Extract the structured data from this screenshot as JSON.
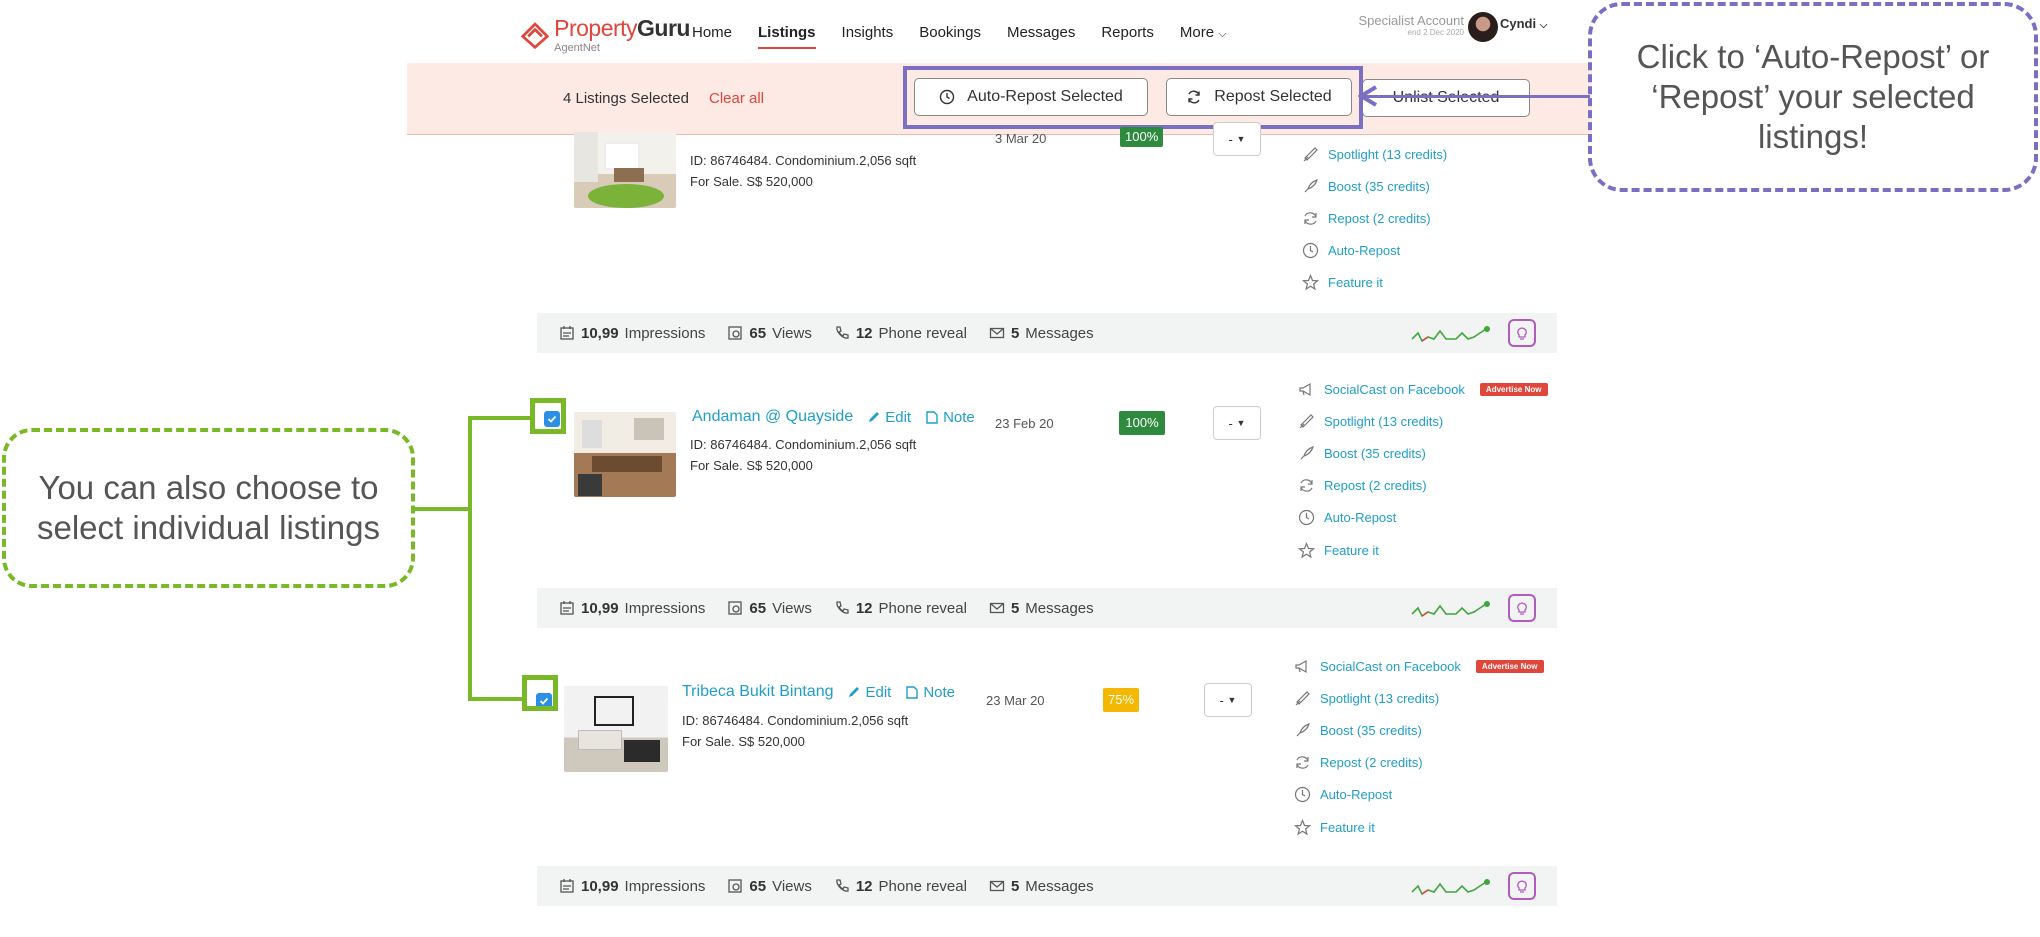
{
  "header": {
    "logo_main": "Property",
    "logo_bold": "Guru",
    "logo_sub": "AgentNet",
    "nav": [
      "Home",
      "Listings",
      "Insights",
      "Bookings",
      "Messages",
      "Reports",
      "More"
    ],
    "account_label": "Specialist Account",
    "account_sub": "end 2 Dec 2020",
    "user_name": "Cyndi"
  },
  "selection_bar": {
    "count_text": "4 Listings Selected",
    "clear_all": "Clear all",
    "auto_repost": "Auto-Repost Selected",
    "repost": "Repost Selected",
    "unlist": "Unlist Selected"
  },
  "listings": [
    {
      "title": "",
      "meta_id": "ID: 86746484.  Condominium.2,056 sqft",
      "meta_sale": "For Sale. S$ 520,000",
      "date": "3 Mar 20",
      "pct": "100%",
      "drop": "-",
      "actions": [
        "Spotlight (13 credits)",
        "Boost (35 credits)",
        "Repost (2 credits)",
        "Auto-Repost",
        "Feature it"
      ]
    },
    {
      "title": "Andaman @ Quayside",
      "edit": "Edit",
      "note": "Note",
      "meta_id": "ID: 86746484.  Condominium.2,056 sqft",
      "meta_sale": "For Sale. S$ 520,000",
      "date": "23 Feb 20",
      "pct": "100%",
      "drop": "-",
      "social": "SocialCast on Facebook",
      "badge": "Advertise Now",
      "actions": [
        "Spotlight (13 credits)",
        "Boost (35 credits)",
        "Repost (2 credits)",
        "Auto-Repost",
        "Feature it"
      ]
    },
    {
      "title": "Tribeca Bukit Bintang",
      "edit": "Edit",
      "note": "Note",
      "meta_id": "ID: 86746484.  Condominium.2,056 sqft",
      "meta_sale": "For Sale. S$ 520,000",
      "date": "23 Mar 20",
      "pct": "75%",
      "drop": "-",
      "social": "SocialCast on Facebook",
      "badge": "Advertise Now",
      "actions": [
        "Spotlight (13 credits)",
        "Boost (35 credits)",
        "Repost (2 credits)",
        "Auto-Repost",
        "Feature it"
      ]
    }
  ],
  "stats": {
    "impressions_val": "10,99",
    "impressions": "Impressions",
    "views_val": "65",
    "views": "Views",
    "phone_val": "12",
    "phone": "Phone reveal",
    "msg_val": "5",
    "msg": "Messages"
  },
  "callouts": {
    "purple": "Click to ‘Auto-Repost’  or ‘Repost’ your selected listings!",
    "green": "You can also choose to select individual listings"
  },
  "colors": {
    "brand_red": "#e0463b",
    "link_blue": "#1f9ec9",
    "callout_purple": "#7b6fc3",
    "callout_green": "#79b827",
    "pct_green": "#2e8b3e",
    "pct_yellow": "#f5b800"
  }
}
